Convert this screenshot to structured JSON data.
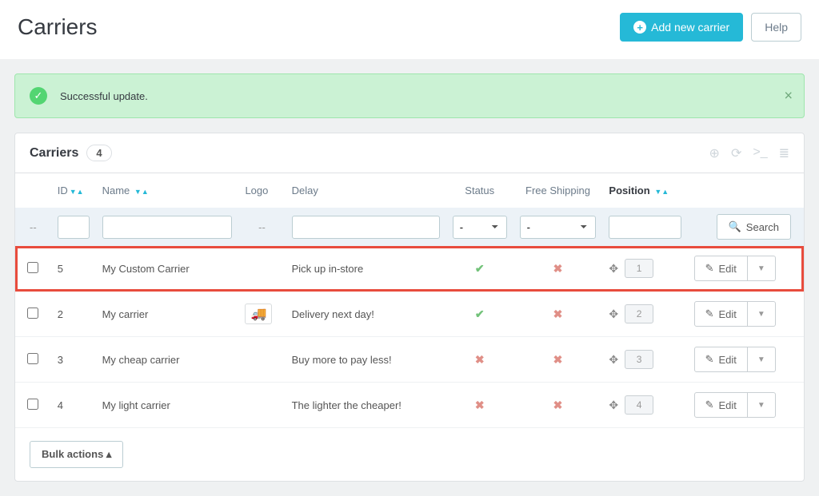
{
  "page": {
    "title": "Carriers"
  },
  "buttons": {
    "add": "Add new carrier",
    "help": "Help",
    "search": "Search",
    "edit": "Edit",
    "bulk": "Bulk actions"
  },
  "alert": {
    "message": "Successful update."
  },
  "panel": {
    "title": "Carriers",
    "count": "4"
  },
  "columns": {
    "id": "ID",
    "name": "Name",
    "logo": "Logo",
    "delay": "Delay",
    "status": "Status",
    "free": "Free Shipping",
    "position": "Position"
  },
  "filter": {
    "dash": "--",
    "selectDefault": "-"
  },
  "rows": [
    {
      "id": "5",
      "name": "My Custom Carrier",
      "logo": false,
      "delay": "Pick up in-store",
      "status": true,
      "free": false,
      "position": "1",
      "highlight": true
    },
    {
      "id": "2",
      "name": "My carrier",
      "logo": true,
      "delay": "Delivery next day!",
      "status": true,
      "free": false,
      "position": "2",
      "highlight": false
    },
    {
      "id": "3",
      "name": "My cheap carrier",
      "logo": false,
      "delay": "Buy more to pay less!",
      "status": false,
      "free": false,
      "position": "3",
      "highlight": false
    },
    {
      "id": "4",
      "name": "My light carrier",
      "logo": false,
      "delay": "The lighter the cheaper!",
      "status": false,
      "free": false,
      "position": "4",
      "highlight": false
    }
  ]
}
